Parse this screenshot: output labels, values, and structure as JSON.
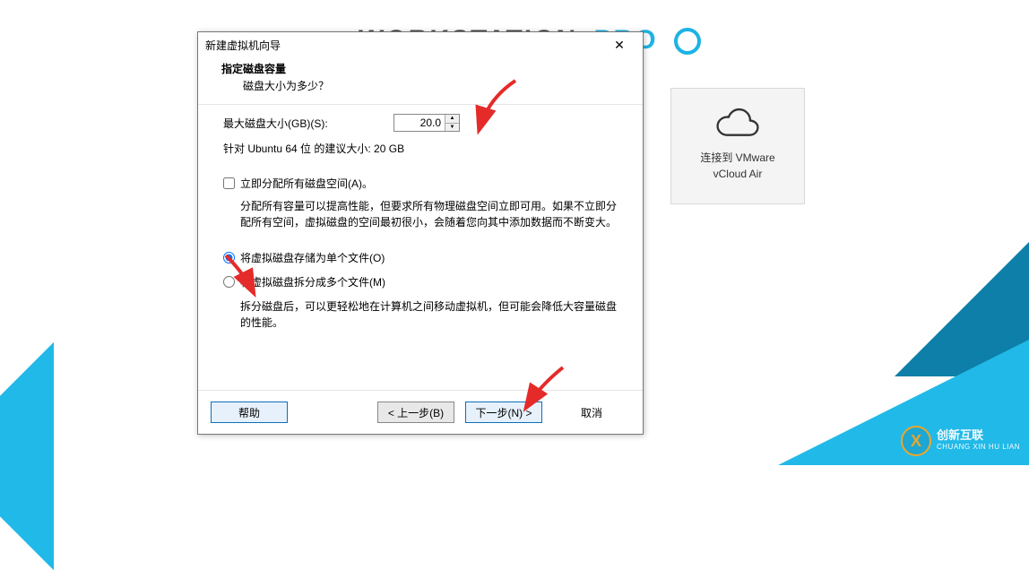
{
  "background": {
    "workstation_text": "WORKSTATION",
    "pro_text": "PRO"
  },
  "vcloud_card": {
    "line1": "连接到 VMware",
    "line2": "vCloud Air"
  },
  "dialog": {
    "title": "新建虚拟机向导",
    "header_title": "指定磁盘容量",
    "header_subtitle": "磁盘大小为多少？",
    "disk_size_label": "最大磁盘大小(GB)(S):",
    "disk_size_value": "20.0",
    "recommended_text": "针对 Ubuntu 64 位 的建议大小: 20 GB",
    "allocate_now_label": "立即分配所有磁盘空间(A)。",
    "allocate_now_explain": "分配所有容量可以提高性能，但要求所有物理磁盘空间立即可用。如果不立即分配所有空间，虚拟磁盘的空间最初很小，会随着您向其中添加数据而不断变大。",
    "radio_single_label": "将虚拟磁盘存储为单个文件(O)",
    "radio_split_label": "将虚拟磁盘拆分成多个文件(M)",
    "radio_split_explain": "拆分磁盘后，可以更轻松地在计算机之间移动虚拟机，但可能会降低大容量磁盘的性能。",
    "buttons": {
      "help": "帮助",
      "back": "< 上一步(B)",
      "next": "下一步(N) >",
      "cancel": "取消"
    }
  },
  "watermark": {
    "cn": "创新互联",
    "en": "CHUANG XIN HU LIAN"
  }
}
